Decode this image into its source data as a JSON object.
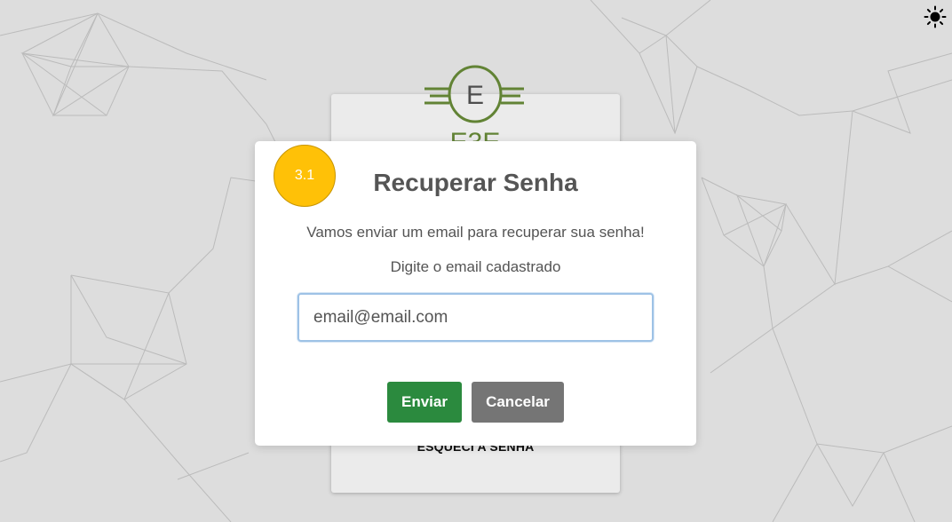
{
  "theme_toggle": {
    "icon": "sun-icon"
  },
  "logo": {
    "letter": "E",
    "partial_text": "E3E",
    "color": "#6b8f3a"
  },
  "login_card": {
    "forgot_password_link": "ESQUECI A SENHA"
  },
  "modal": {
    "step_badge": "3.1",
    "title": "Recuperar Senha",
    "description": "Vamos enviar um email para recuperar sua senha!",
    "prompt": "Digite o email cadastrado",
    "email_value": "email@email.com",
    "send_button": "Enviar",
    "cancel_button": "Cancelar"
  },
  "colors": {
    "badge": "#ffc107",
    "send_button": "#2b8a3e",
    "cancel_button": "#757575",
    "input_focus": "#9ec2e6"
  }
}
